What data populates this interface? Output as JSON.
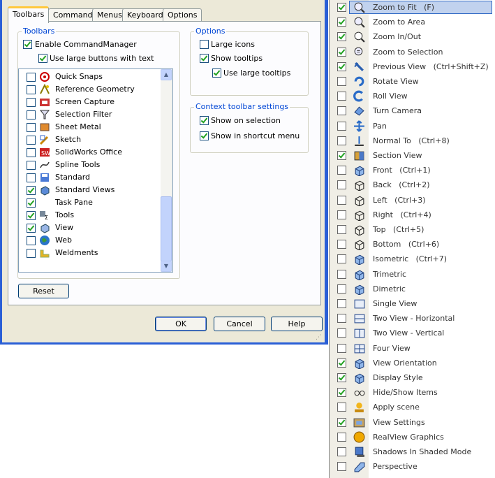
{
  "dialog": {
    "tabs": [
      "Toolbars",
      "Commands",
      "Menus",
      "Keyboard",
      "Options"
    ],
    "toolbars_group": {
      "title": "Toolbars",
      "enable_cm": {
        "label": "Enable CommandManager",
        "checked": true
      },
      "large_buttons": {
        "label": "Use large buttons with text",
        "checked": true
      }
    },
    "toolbar_list": [
      {
        "label": "Quick Snaps",
        "checked": false,
        "icon": "quick-snaps-icon"
      },
      {
        "label": "Reference Geometry",
        "checked": false,
        "icon": "reference-geometry-icon"
      },
      {
        "label": "Screen Capture",
        "checked": false,
        "icon": "screen-capture-icon"
      },
      {
        "label": "Selection Filter",
        "checked": false,
        "icon": "selection-filter-icon"
      },
      {
        "label": "Sheet Metal",
        "checked": false,
        "icon": "sheet-metal-icon"
      },
      {
        "label": "Sketch",
        "checked": false,
        "icon": "sketch-icon"
      },
      {
        "label": "SolidWorks Office",
        "checked": false,
        "icon": "solidworks-office-icon"
      },
      {
        "label": "Spline Tools",
        "checked": false,
        "icon": "spline-tools-icon"
      },
      {
        "label": "Standard",
        "checked": false,
        "icon": "standard-icon"
      },
      {
        "label": "Standard Views",
        "checked": true,
        "icon": "standard-views-icon"
      },
      {
        "label": "Task Pane",
        "checked": true,
        "icon": ""
      },
      {
        "label": "Tools",
        "checked": true,
        "icon": "tools-icon"
      },
      {
        "label": "View",
        "checked": true,
        "icon": "view-icon"
      },
      {
        "label": "Web",
        "checked": false,
        "icon": "web-globe-icon"
      },
      {
        "label": "Weldments",
        "checked": false,
        "icon": "weldments-icon"
      }
    ],
    "options_group": {
      "title": "Options",
      "large_icons": {
        "label": "Large icons",
        "checked": false
      },
      "show_tooltips": {
        "label": "Show tooltips",
        "checked": true
      },
      "large_tooltips": {
        "label": "Use large tooltips",
        "checked": true
      }
    },
    "context_group": {
      "title": "Context toolbar settings",
      "show_on_selection": {
        "label": "Show on selection",
        "checked": true
      },
      "show_in_shortcut": {
        "label": "Show in shortcut menu",
        "checked": true
      }
    },
    "buttons": {
      "reset": "Reset",
      "ok": "OK",
      "cancel": "Cancel",
      "help": "Help"
    }
  },
  "menu_items": [
    {
      "label": "Zoom to Fit   (F)",
      "checked": true,
      "icon": "zoom-to-fit-icon",
      "highlight": true
    },
    {
      "label": "Zoom to Area",
      "checked": true,
      "icon": "zoom-to-area-icon"
    },
    {
      "label": "Zoom In/Out",
      "checked": true,
      "icon": "zoom-in-out-icon"
    },
    {
      "label": "Zoom to Selection",
      "checked": true,
      "icon": "zoom-to-selection-icon"
    },
    {
      "label": "Previous View   (Ctrl+Shift+Z)",
      "checked": true,
      "icon": "previous-view-icon"
    },
    {
      "label": "Rotate View",
      "checked": false,
      "icon": "rotate-view-icon"
    },
    {
      "label": "Roll View",
      "checked": false,
      "icon": "roll-view-icon"
    },
    {
      "label": "Turn Camera",
      "checked": false,
      "icon": "turn-camera-icon"
    },
    {
      "label": "Pan",
      "checked": false,
      "icon": "pan-icon"
    },
    {
      "label": "Normal To   (Ctrl+8)",
      "checked": false,
      "icon": "normal-to-icon"
    },
    {
      "label": "Section View",
      "checked": true,
      "icon": "section-view-icon"
    },
    {
      "label": "Front   (Ctrl+1)",
      "checked": false,
      "icon": "front-view-icon"
    },
    {
      "label": "Back   (Ctrl+2)",
      "checked": false,
      "icon": "back-view-icon"
    },
    {
      "label": "Left   (Ctrl+3)",
      "checked": false,
      "icon": "left-view-icon"
    },
    {
      "label": "Right   (Ctrl+4)",
      "checked": false,
      "icon": "right-view-icon"
    },
    {
      "label": "Top   (Ctrl+5)",
      "checked": false,
      "icon": "top-view-icon"
    },
    {
      "label": "Bottom   (Ctrl+6)",
      "checked": false,
      "icon": "bottom-view-icon"
    },
    {
      "label": "Isometric   (Ctrl+7)",
      "checked": false,
      "icon": "isometric-icon"
    },
    {
      "label": "Trimetric",
      "checked": false,
      "icon": "trimetric-icon"
    },
    {
      "label": "Dimetric",
      "checked": false,
      "icon": "dimetric-icon"
    },
    {
      "label": "Single View",
      "checked": false,
      "icon": "single-view-icon"
    },
    {
      "label": "Two View - Horizontal",
      "checked": false,
      "icon": "two-view-horizontal-icon"
    },
    {
      "label": "Two View - Vertical",
      "checked": false,
      "icon": "two-view-vertical-icon"
    },
    {
      "label": "Four View",
      "checked": false,
      "icon": "four-view-icon"
    },
    {
      "label": "View Orientation",
      "checked": true,
      "icon": "view-orientation-icon"
    },
    {
      "label": "Display Style",
      "checked": true,
      "icon": "display-style-icon"
    },
    {
      "label": "Hide/Show Items",
      "checked": true,
      "icon": "hide-show-items-icon"
    },
    {
      "label": "Apply scene",
      "checked": false,
      "icon": "apply-scene-icon"
    },
    {
      "label": "View Settings",
      "checked": true,
      "icon": "view-settings-icon"
    },
    {
      "label": "RealView Graphics",
      "checked": false,
      "icon": "realview-graphics-icon"
    },
    {
      "label": "Shadows In Shaded Mode",
      "checked": false,
      "icon": "shadows-icon"
    },
    {
      "label": "Perspective",
      "checked": false,
      "icon": "perspective-icon"
    }
  ]
}
